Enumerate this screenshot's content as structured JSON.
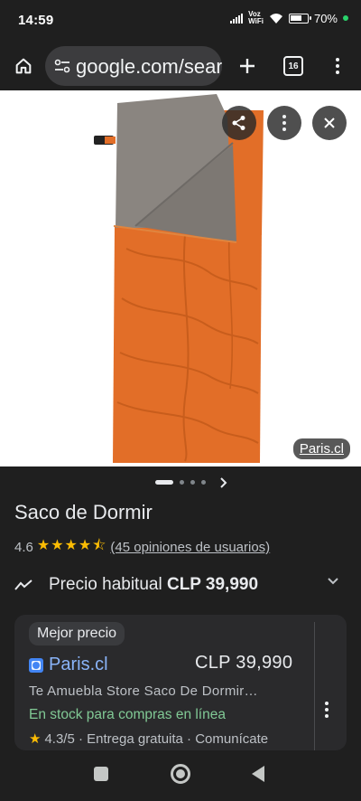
{
  "status_bar": {
    "time": "14:59",
    "network_label_1": "Voz",
    "network_label_2": "WiFi",
    "battery": "70%",
    "battery_level": 0.7
  },
  "browser": {
    "url": "google.com/search",
    "tab_count": "16"
  },
  "image": {
    "source": "Paris.cl",
    "carousel_total": 4,
    "carousel_active": 0
  },
  "product": {
    "title": "Saco de Dormir",
    "rating": "4.6",
    "stars": "★★★★⯪",
    "reviews": "(45 opiniones de usuarios)",
    "price_label": "Precio habitual",
    "price_value": "CLP 39,990"
  },
  "offer": {
    "badge": "Mejor precio",
    "merchant": "Paris.cl",
    "price": "CLP 39,990",
    "description": "Te Amuebla Store Saco De Dormir…",
    "stock": "En stock para compras en línea",
    "star": "★",
    "meta": "4.3/5 · Entrega gratuita · Comunícate"
  },
  "colors": {
    "accent_link": "#8ab4f8",
    "stock_green": "#81c995",
    "star_yellow": "#fbbc04",
    "bag_orange": "#e26e28",
    "lining_gray": "#8a8580"
  },
  "icons": [
    "home-icon",
    "site-settings-icon",
    "plus-icon",
    "tab-switcher-icon",
    "menu-icon",
    "share-icon",
    "more-vert-icon",
    "close-icon",
    "trending-icon",
    "chevron-down-icon",
    "chevron-right-icon",
    "recents-icon",
    "home-nav-icon",
    "back-icon"
  ]
}
